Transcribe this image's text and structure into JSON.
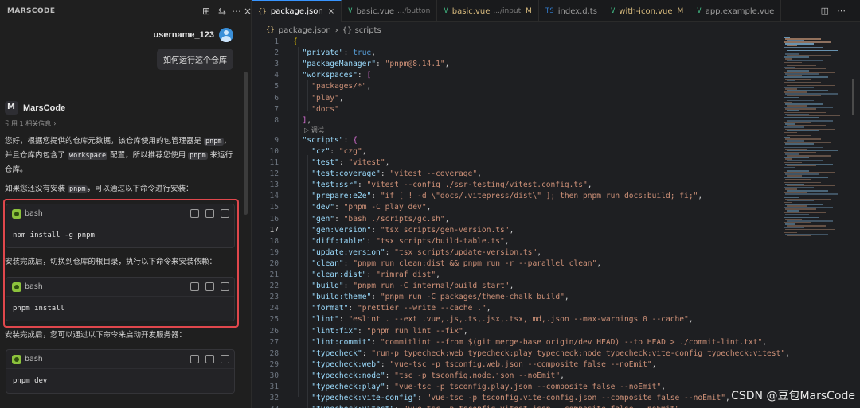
{
  "chat": {
    "title": "MARSCODE",
    "header_icons": [
      "new-chat-icon",
      "settings-icon",
      "more-icon",
      "close-icon"
    ],
    "user": {
      "name": "username_123",
      "message": "如何运行这个仓库"
    },
    "bot": {
      "name": "MarsCode",
      "references": "引用 1 相关信息",
      "intro_parts": [
        "您好，根据您提供的仓库元数据，该仓库使用的包管理器是 ",
        "pnpm",
        "，并且仓库内包含了 ",
        "workspace",
        " 配置，所以推荐您使用 ",
        "pnpm",
        " 来运行仓库。"
      ],
      "install_hint_parts": [
        "如果您还没有安装 ",
        "pnpm",
        "，可以通过以下命令进行安装："
      ],
      "after_install": "安装完成后，切换到仓库的根目录，执行以下命令来安装依赖：",
      "after_deps": "安装完成后，您可以通过以下命令来启动开发服务器：",
      "code_blocks": [
        {
          "lang": "bash",
          "code": "npm install -g pnpm"
        },
        {
          "lang": "bash",
          "code": "pnpm install"
        },
        {
          "lang": "bash",
          "code": "pnpm dev"
        }
      ]
    }
  },
  "editor": {
    "tabs": [
      {
        "icon": "{}",
        "label": "package.json",
        "desc": "",
        "modified": "",
        "active": true,
        "close": "×"
      },
      {
        "icon": "V",
        "label": "basic.vue",
        "desc": ".../button",
        "modified": "",
        "active": false,
        "close": ""
      },
      {
        "icon": "V",
        "label": "basic.vue",
        "desc": ".../input",
        "modified": "M",
        "active": false,
        "close": ""
      },
      {
        "icon": "TS",
        "label": "index.d.ts",
        "desc": "",
        "modified": "",
        "active": false,
        "close": ""
      },
      {
        "icon": "V",
        "label": "with-icon.vue",
        "desc": "",
        "modified": "M",
        "active": false,
        "close": ""
      },
      {
        "icon": "V",
        "label": "app.example.vue",
        "desc": "",
        "modified": "",
        "active": false,
        "close": ""
      }
    ],
    "breadcrumb": [
      "package.json",
      "{} scripts"
    ],
    "current_line": 17,
    "codelens": "▷ 调试",
    "lines": [
      {
        "n": 1,
        "indent": 0,
        "tokens": [
          [
            "br1",
            "{"
          ]
        ]
      },
      {
        "n": 2,
        "indent": 1,
        "tokens": [
          [
            "k",
            "\"private\""
          ],
          [
            "p",
            ": "
          ],
          [
            "b",
            "true"
          ],
          [
            "p",
            ","
          ]
        ]
      },
      {
        "n": 3,
        "indent": 1,
        "tokens": [
          [
            "k",
            "\"packageManager\""
          ],
          [
            "p",
            ": "
          ],
          [
            "s",
            "\"pnpm@8.14.1\""
          ],
          [
            "p",
            ","
          ]
        ]
      },
      {
        "n": 4,
        "indent": 1,
        "tokens": [
          [
            "k",
            "\"workspaces\""
          ],
          [
            "p",
            ": "
          ],
          [
            "br2",
            "["
          ]
        ]
      },
      {
        "n": 5,
        "indent": 2,
        "tokens": [
          [
            "s",
            "\"packages/*\""
          ],
          [
            "p",
            ","
          ]
        ]
      },
      {
        "n": 6,
        "indent": 2,
        "tokens": [
          [
            "s",
            "\"play\""
          ],
          [
            "p",
            ","
          ]
        ]
      },
      {
        "n": 7,
        "indent": 2,
        "tokens": [
          [
            "s",
            "\"docs\""
          ]
        ]
      },
      {
        "n": 8,
        "indent": 1,
        "tokens": [
          [
            "br2",
            "]"
          ],
          [
            "p",
            ","
          ]
        ]
      },
      {
        "n": 9,
        "indent": 1,
        "tokens": [
          [
            "k",
            "\"scripts\""
          ],
          [
            "p",
            ": "
          ],
          [
            "br2",
            "{"
          ]
        ]
      },
      {
        "n": 10,
        "indent": 2,
        "tokens": [
          [
            "k",
            "\"cz\""
          ],
          [
            "p",
            ": "
          ],
          [
            "s",
            "\"czg\""
          ],
          [
            "p",
            ","
          ]
        ]
      },
      {
        "n": 11,
        "indent": 2,
        "tokens": [
          [
            "k",
            "\"test\""
          ],
          [
            "p",
            ": "
          ],
          [
            "s",
            "\"vitest\""
          ],
          [
            "p",
            ","
          ]
        ]
      },
      {
        "n": 12,
        "indent": 2,
        "tokens": [
          [
            "k",
            "\"test:coverage\""
          ],
          [
            "p",
            ": "
          ],
          [
            "s",
            "\"vitest --coverage\""
          ],
          [
            "p",
            ","
          ]
        ]
      },
      {
        "n": 13,
        "indent": 2,
        "tokens": [
          [
            "k",
            "\"test:ssr\""
          ],
          [
            "p",
            ": "
          ],
          [
            "s",
            "\"vitest --config ./ssr-testing/vitest.config.ts\""
          ],
          [
            "p",
            ","
          ]
        ]
      },
      {
        "n": 14,
        "indent": 2,
        "tokens": [
          [
            "k",
            "\"prepare:e2e\""
          ],
          [
            "p",
            ": "
          ],
          [
            "s",
            "\"if [ ! -d \\\"docs/.vitepress/dist\\\" ]; then pnpm run docs:build; fi;\""
          ],
          [
            "p",
            ","
          ]
        ]
      },
      {
        "n": 15,
        "indent": 2,
        "tokens": [
          [
            "k",
            "\"dev\""
          ],
          [
            "p",
            ": "
          ],
          [
            "s",
            "\"pnpm -C play dev\""
          ],
          [
            "p",
            ","
          ]
        ]
      },
      {
        "n": 16,
        "indent": 2,
        "tokens": [
          [
            "k",
            "\"gen\""
          ],
          [
            "p",
            ": "
          ],
          [
            "s",
            "\"bash ./scripts/gc.sh\""
          ],
          [
            "p",
            ","
          ]
        ]
      },
      {
        "n": 17,
        "indent": 2,
        "tokens": [
          [
            "k",
            "\"gen:version\""
          ],
          [
            "p",
            ": "
          ],
          [
            "s",
            "\"tsx scripts/gen-version.ts\""
          ],
          [
            "p",
            ","
          ]
        ]
      },
      {
        "n": 18,
        "indent": 2,
        "tokens": [
          [
            "k",
            "\"diff:table\""
          ],
          [
            "p",
            ": "
          ],
          [
            "s",
            "\"tsx scripts/build-table.ts\""
          ],
          [
            "p",
            ","
          ]
        ]
      },
      {
        "n": 19,
        "indent": 2,
        "tokens": [
          [
            "k",
            "\"update:version\""
          ],
          [
            "p",
            ": "
          ],
          [
            "s",
            "\"tsx scripts/update-version.ts\""
          ],
          [
            "p",
            ","
          ]
        ]
      },
      {
        "n": 20,
        "indent": 2,
        "tokens": [
          [
            "k",
            "\"clean\""
          ],
          [
            "p",
            ": "
          ],
          [
            "s",
            "\"pnpm run clean:dist && pnpm run -r --parallel clean\""
          ],
          [
            "p",
            ","
          ]
        ]
      },
      {
        "n": 21,
        "indent": 2,
        "tokens": [
          [
            "k",
            "\"clean:dist\""
          ],
          [
            "p",
            ": "
          ],
          [
            "s",
            "\"rimraf dist\""
          ],
          [
            "p",
            ","
          ]
        ]
      },
      {
        "n": 22,
        "indent": 2,
        "tokens": [
          [
            "k",
            "\"build\""
          ],
          [
            "p",
            ": "
          ],
          [
            "s",
            "\"pnpm run -C internal/build start\""
          ],
          [
            "p",
            ","
          ]
        ]
      },
      {
        "n": 23,
        "indent": 2,
        "tokens": [
          [
            "k",
            "\"build:theme\""
          ],
          [
            "p",
            ": "
          ],
          [
            "s",
            "\"pnpm run -C packages/theme-chalk build\""
          ],
          [
            "p",
            ","
          ]
        ]
      },
      {
        "n": 24,
        "indent": 2,
        "tokens": [
          [
            "k",
            "\"format\""
          ],
          [
            "p",
            ": "
          ],
          [
            "s",
            "\"prettier --write --cache .\""
          ],
          [
            "p",
            ","
          ]
        ]
      },
      {
        "n": 25,
        "indent": 2,
        "tokens": [
          [
            "k",
            "\"lint\""
          ],
          [
            "p",
            ": "
          ],
          [
            "s",
            "\"eslint . --ext .vue,.js,.ts,.jsx,.tsx,.md,.json --max-warnings 0 --cache\""
          ],
          [
            "p",
            ","
          ]
        ]
      },
      {
        "n": 26,
        "indent": 2,
        "tokens": [
          [
            "k",
            "\"lint:fix\""
          ],
          [
            "p",
            ": "
          ],
          [
            "s",
            "\"pnpm run lint --fix\""
          ],
          [
            "p",
            ","
          ]
        ]
      },
      {
        "n": 27,
        "indent": 2,
        "tokens": [
          [
            "k",
            "\"lint:commit\""
          ],
          [
            "p",
            ": "
          ],
          [
            "s",
            "\"commitlint --from $(git merge-base origin/dev HEAD) --to HEAD > ./commit-lint.txt\""
          ],
          [
            "p",
            ","
          ]
        ]
      },
      {
        "n": 28,
        "indent": 2,
        "tokens": [
          [
            "k",
            "\"typecheck\""
          ],
          [
            "p",
            ": "
          ],
          [
            "s",
            "\"run-p typecheck:web typecheck:play typecheck:node typecheck:vite-config typecheck:vitest\""
          ],
          [
            "p",
            ","
          ]
        ]
      },
      {
        "n": 29,
        "indent": 2,
        "tokens": [
          [
            "k",
            "\"typecheck:web\""
          ],
          [
            "p",
            ": "
          ],
          [
            "s",
            "\"vue-tsc -p tsconfig.web.json --composite false --noEmit\""
          ],
          [
            "p",
            ","
          ]
        ]
      },
      {
        "n": 30,
        "indent": 2,
        "tokens": [
          [
            "k",
            "\"typecheck:node\""
          ],
          [
            "p",
            ": "
          ],
          [
            "s",
            "\"tsc -p tsconfig.node.json --noEmit\""
          ],
          [
            "p",
            ","
          ]
        ]
      },
      {
        "n": 31,
        "indent": 2,
        "tokens": [
          [
            "k",
            "\"typecheck:play\""
          ],
          [
            "p",
            ": "
          ],
          [
            "s",
            "\"vue-tsc -p tsconfig.play.json --composite false --noEmit\""
          ],
          [
            "p",
            ","
          ]
        ]
      },
      {
        "n": 32,
        "indent": 2,
        "tokens": [
          [
            "k",
            "\"typecheck:vite-config\""
          ],
          [
            "p",
            ": "
          ],
          [
            "s",
            "\"vue-tsc -p tsconfig.vite-config.json --composite false --noEmit\""
          ],
          [
            "p",
            ","
          ]
        ]
      },
      {
        "n": 33,
        "indent": 2,
        "tokens": [
          [
            "k",
            "\"typecheck:vitest\""
          ],
          [
            "p",
            ": "
          ],
          [
            "s",
            "\"vue-tsc -p tsconfig.vitest.json --composite false --noEmit\""
          ],
          [
            "p",
            ","
          ]
        ]
      }
    ]
  },
  "watermark": "CSDN @豆包MarsCode",
  "colors": {
    "accent": "#3794ff",
    "highlight_box": "#e0474c",
    "json_key": "#9cdcfe",
    "json_string": "#ce9178",
    "json_keyword": "#569cd6"
  }
}
